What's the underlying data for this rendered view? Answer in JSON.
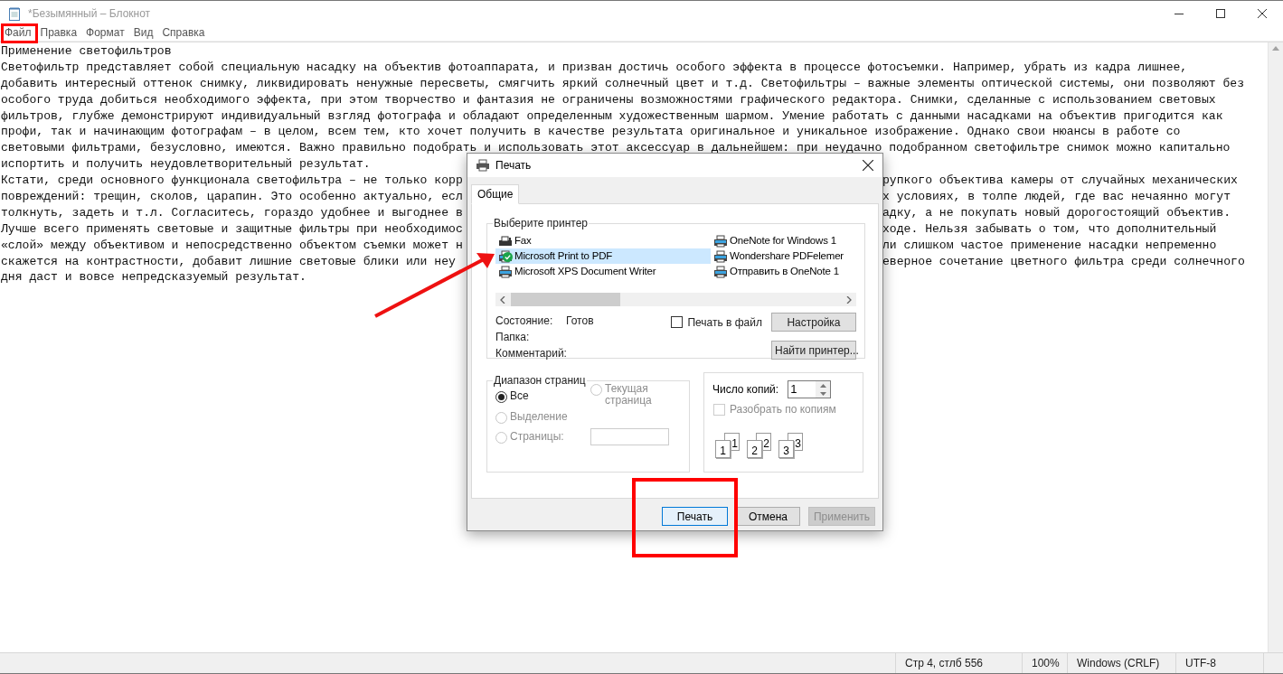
{
  "window": {
    "title": "*Безымянный – Блокнот"
  },
  "menu": [
    {
      "label": "Файл"
    },
    {
      "label": "Правка"
    },
    {
      "label": "Формат"
    },
    {
      "label": "Вид"
    },
    {
      "label": "Справка"
    }
  ],
  "editor": {
    "lines": [
      {
        "text": "Применение светофильтров"
      },
      {
        "text": "Светофильтр представляет собой специальную насадку на объектив фотоаппарата, и призван достичь особого эффекта в процессе фотосъемки. Например, убрать из кадра лишнее,"
      },
      {
        "text": "добавить интересный оттенок снимку, ликвидировать ненужные пересветы, смягчить яркий солнечный цвет и т.д. Светофильтры – важные элементы оптической системы, они позволяют без"
      },
      {
        "text": "особого труда добиться необходимого эффекта, при этом творчество и фантазия не ограничены возможностями графического редактора. Снимки, сделанные с использованием световых"
      },
      {
        "text": "фильтров, глубже демонстрируют индивидуальный взгляд фотографа и обладают определенным художественным шармом. Умение работать с данными насадками на объектив пригодится как"
      },
      {
        "text": "профи, так и начинающим фотографам – в целом, всем тем, кто хочет получить в качестве результата оригинальное и уникальное изображение. Однако свои нюансы в работе со"
      },
      {
        "text": "световыми фильтрами, безусловно, имеются. Важно правильно подобрать и использовать этот аксессуар в дальнейшем: при неудачно подобранном светофильтре снимок можно капитально"
      },
      {
        "text": "испортить и получить неудовлетворительный результат."
      },
      {
        "text": "Кстати, среди основного функционала светофильтра – не только корр",
        "after_dialog": "рупкого объектива камеры от случайных механических"
      },
      {
        "text": "повреждений: трещин, сколов, царапин. Это особенно актуально, есл",
        "after_dialog": "х условиях, в толпе людей, где вас нечаянно могут"
      },
      {
        "text": "толкнуть, задеть и т.л. Согласитесь, гораздо удобнее и выгоднее в",
        "after_dialog": "адку, а не покупать новый дорогостоящий объектив."
      },
      {
        "text": "Лучше всего применять световые и защитные фильтры при необходимос",
        "after_dialog": "ходе. Нельзя забывать о том, что дополнительный"
      },
      {
        "text": "«слой» между объективом и непосредственно объектом съемки может н",
        "after_dialog": "ли слишком частое применение насадки непременно"
      },
      {
        "text": "скажется на контрастности, добавит лишние световые блики или неу",
        "after_dialog": "еверное сочетание цветного фильтра среди солнечного"
      },
      {
        "text": "дня даст и вовсе непредсказуемый результат."
      }
    ]
  },
  "print_dialog": {
    "title": "Печать",
    "tabs": [
      {
        "label": "Общие",
        "selected": true
      }
    ],
    "printer_group": {
      "title": "Выберите принтер",
      "printers": [
        {
          "name": "Fax",
          "kind": "fax",
          "selected": false,
          "default": false
        },
        {
          "name": "Microsoft Print to PDF",
          "kind": "printer",
          "selected": true,
          "default": true
        },
        {
          "name": "Microsoft XPS Document Writer",
          "kind": "printer",
          "selected": false,
          "default": false
        },
        {
          "name": "OneNote for Windows 1",
          "kind": "printer",
          "selected": false,
          "default": false
        },
        {
          "name": "Wondershare PDFelemer",
          "kind": "printer",
          "selected": false,
          "default": false
        },
        {
          "name": "Отправить в OneNote 1",
          "kind": "printer",
          "selected": false,
          "default": false
        }
      ],
      "status_label": "Состояние:",
      "status_value": "Готов",
      "folder_label": "Папка:",
      "comment_label": "Комментарий:",
      "print_to_file": {
        "label": "Печать в файл",
        "checked": false
      },
      "preferences_button": "Настройка",
      "find_printer_button": "Найти принтер..."
    },
    "page_range": {
      "title": "Диапазон страниц",
      "options": [
        {
          "label": "Все",
          "selected": true,
          "disabled": false
        },
        {
          "label": "Текущая страница",
          "selected": false,
          "disabled": true
        },
        {
          "label": "Выделение",
          "selected": false,
          "disabled": true
        },
        {
          "label": "Страницы:",
          "selected": false,
          "disabled": true
        }
      ]
    },
    "copies": {
      "label": "Число копий:",
      "value": "1",
      "collate": {
        "label": "Разобрать по копиям",
        "checked": false,
        "disabled": true
      },
      "collate_pages": [
        {
          "front": "1",
          "back": "1"
        },
        {
          "front": "2",
          "back": "2"
        },
        {
          "front": "3",
          "back": "3"
        }
      ]
    },
    "buttons": [
      {
        "label": "Печать",
        "kind": "default",
        "disabled": false
      },
      {
        "label": "Отмена",
        "kind": "normal",
        "disabled": false
      },
      {
        "label": "Применить",
        "kind": "normal",
        "disabled": true
      }
    ]
  },
  "status_bar": [
    "Стр 4, стлб 556",
    "100%",
    "Windows (CRLF)",
    "UTF-8"
  ]
}
